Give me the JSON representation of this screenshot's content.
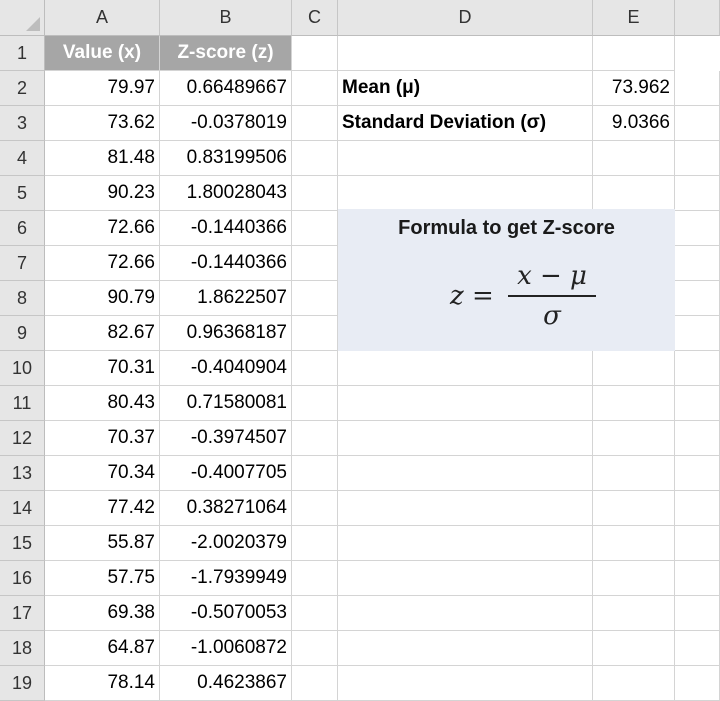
{
  "columns": [
    "A",
    "B",
    "C",
    "D",
    "E"
  ],
  "rows": [
    "1",
    "2",
    "3",
    "4",
    "5",
    "6",
    "7",
    "8",
    "9",
    "10",
    "11",
    "12",
    "13",
    "14",
    "15",
    "16",
    "17",
    "18",
    "19"
  ],
  "table": {
    "header_value": "Value (x)",
    "header_zscore": "Z-score (z)",
    "values": [
      "79.97",
      "73.62",
      "81.48",
      "90.23",
      "72.66",
      "72.66",
      "90.79",
      "82.67",
      "70.31",
      "80.43",
      "70.37",
      "70.34",
      "77.42",
      "55.87",
      "57.75",
      "69.38",
      "64.87",
      "78.14"
    ],
    "zscores": [
      "0.66489667",
      "-0.0378019",
      "0.83199506",
      "1.80028043",
      "-0.1440366",
      "-0.1440366",
      "1.8622507",
      "0.96368187",
      "-0.4040904",
      "0.71580081",
      "-0.3974507",
      "-0.4007705",
      "0.38271064",
      "-2.0020379",
      "-1.7939949",
      "-0.5070053",
      "-1.0060872",
      "0.4623867"
    ]
  },
  "stats": {
    "mean_label": "Mean (μ)",
    "mean_value": "73.962",
    "sd_label": "Standard Deviation (σ)",
    "sd_value": "9.0366"
  },
  "formula": {
    "title": "Formula to get Z-score",
    "lhs": "z =",
    "numerator": "x − μ",
    "denominator": "σ"
  },
  "colors": {
    "header_fill": "#a6a6a6",
    "formula_fill": "#e8ecf4",
    "grid": "#d4d4d4",
    "heading_bg": "#e6e6e6"
  }
}
